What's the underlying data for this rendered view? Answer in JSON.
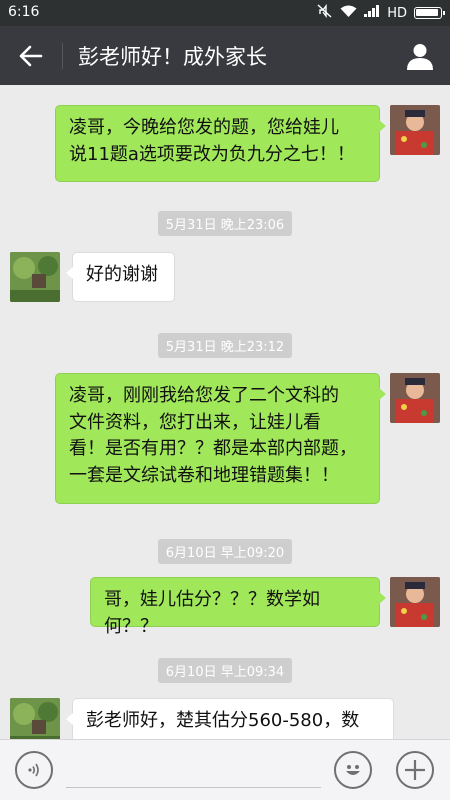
{
  "status_bar": {
    "time": "6:16",
    "network": "HD"
  },
  "header": {
    "title": "彭老师好！成外家长"
  },
  "timestamps": {
    "t1": "5月31日 晚上23:06",
    "t2": "5月31日 晚上23:12",
    "t3": "6月10日 早上09:20",
    "t4": "6月10日 早上09:34"
  },
  "messages": {
    "m1": {
      "line1": "凌哥，今晚给您发的题，您给娃儿",
      "line2": "说11题a选项要改为负九分之七！！"
    },
    "m2": {
      "line1": "好的谢谢"
    },
    "m3": {
      "line1": "凌哥，刚刚我给您发了二个文科的",
      "line2": "文件资料，您打出来，让娃儿看",
      "line3": "看！是否有用？？都是本部内部题，",
      "line4": "一套是文综试卷和地理错题集！！"
    },
    "m4": {
      "line1": "哥，娃儿估分？？？数学如何？？"
    },
    "m5": {
      "line1": "彭老师好，楚其估分560-580，数"
    }
  },
  "input": {
    "placeholder": ""
  },
  "icons": {
    "back": "back-arrow-icon",
    "profile": "person-icon",
    "voice": "voice-icon",
    "emoji": "emoji-icon",
    "plus": "plus-icon"
  },
  "colors": {
    "status_bar": "#2e3132",
    "title_bar": "#393a3f",
    "chat_background": "#ebebeb",
    "outgoing_bubble": "#a0e75a",
    "incoming_bubble": "#ffffff",
    "timestamp_bg": "#cecece"
  }
}
